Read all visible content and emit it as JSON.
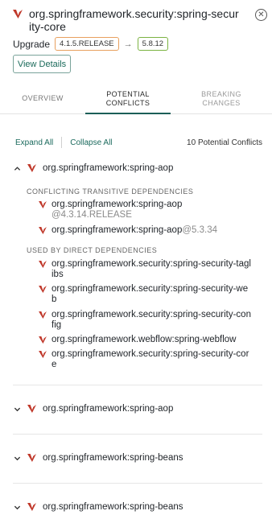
{
  "header": {
    "title": "org.springframework.security:spring-security-core",
    "close_label": "✕",
    "upgrade_label": "Upgrade",
    "from_version": "4.1.5.RELEASE",
    "arrow": "→",
    "to_version": "5.8.12",
    "details_label": "View Details"
  },
  "tabs": [
    {
      "label": "OVERVIEW"
    },
    {
      "label": "POTENTIAL CONFLICTS"
    },
    {
      "label": "BREAKING CHANGES"
    }
  ],
  "toolbar": {
    "expand_all": "Expand All",
    "collapse_all": "Collapse All",
    "conflict_count": "10 Potential Conflicts"
  },
  "groups": [
    {
      "name": "org.springframework:spring-aop",
      "expanded": true,
      "transitive_title": "CONFLICTING TRANSITIVE DEPENDENCIES",
      "transitive": [
        {
          "name": "org.springframework:spring-aop",
          "version": "@4.3.14.RELEASE"
        },
        {
          "name": "org.springframework:spring-aop",
          "version": "@5.3.34"
        }
      ],
      "direct_title": "USED BY DIRECT DEPENDENCIES",
      "direct": [
        {
          "name": "org.springframework.security:spring-security-taglibs"
        },
        {
          "name": "org.springframework.security:spring-security-web"
        },
        {
          "name": "org.springframework.security:spring-security-config"
        },
        {
          "name": "org.springframework.webflow:spring-webflow"
        },
        {
          "name": "org.springframework.security:spring-security-core"
        }
      ]
    },
    {
      "name": "org.springframework:spring-aop",
      "expanded": false
    },
    {
      "name": "org.springframework:spring-beans",
      "expanded": false
    },
    {
      "name": "org.springframework:spring-beans",
      "expanded": false
    }
  ],
  "colors": {
    "accent": "#1b5e57",
    "logo": "#c0392b",
    "old_badge_border": "#e8a05f",
    "new_badge_border": "#7cb342"
  },
  "icons": {
    "logo": "v-logo-icon",
    "close": "close-circle-icon",
    "expanded": "chevron-up-icon",
    "collapsed": "chevron-down-icon"
  }
}
